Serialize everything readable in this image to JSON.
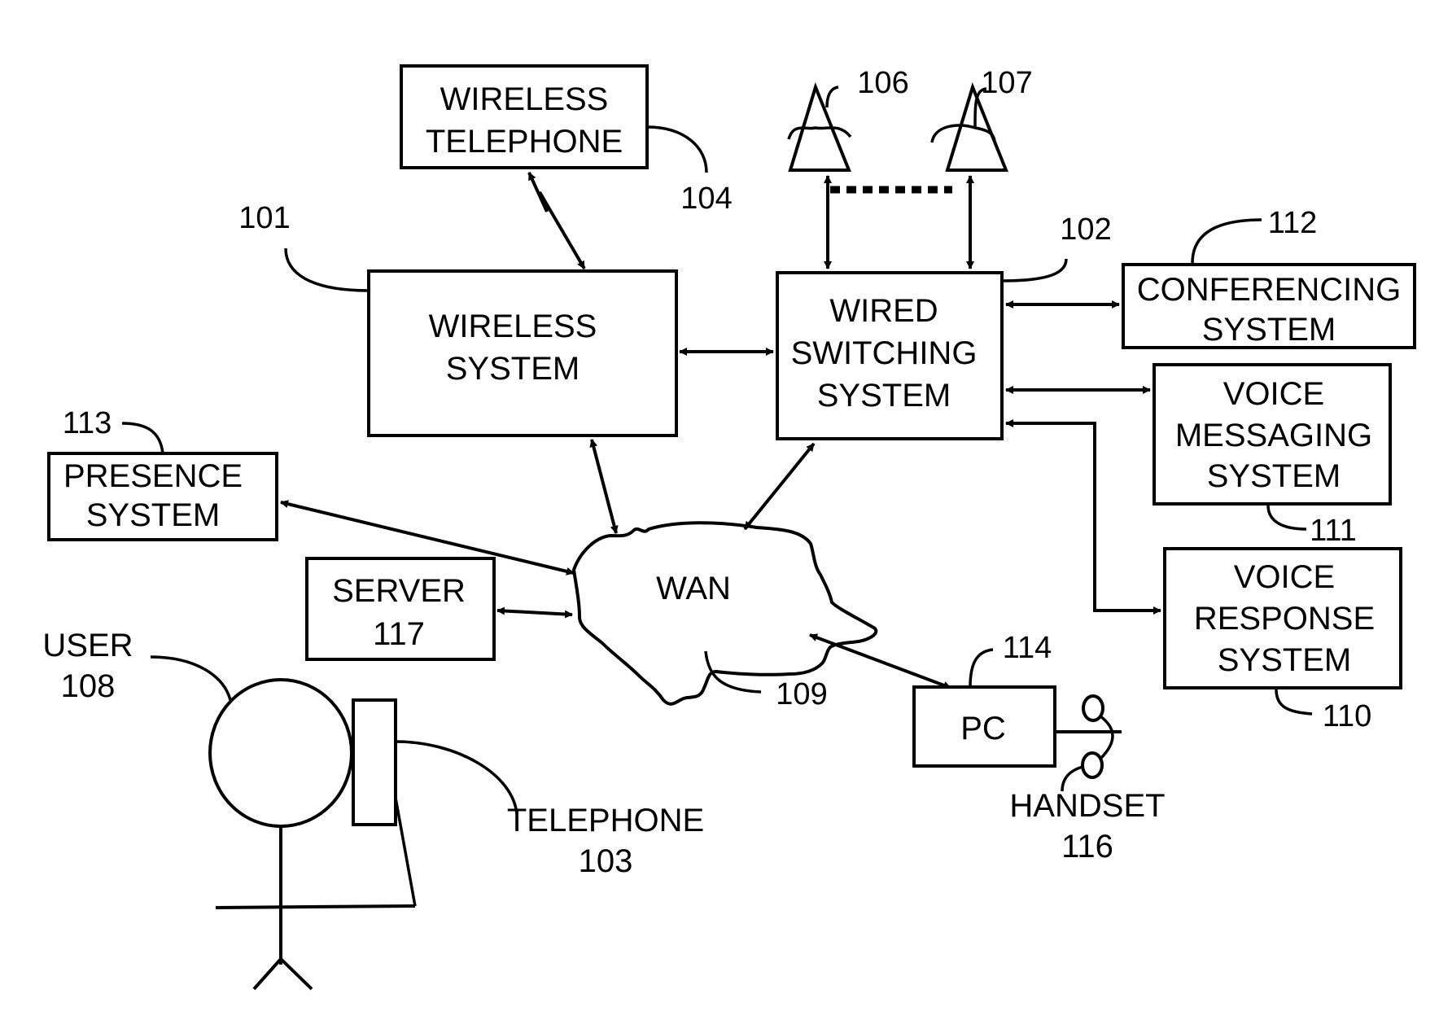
{
  "diagram": {
    "type": "system block diagram",
    "nodes": {
      "wireless_telephone": {
        "lines": [
          "WIRELESS",
          "TELEPHONE"
        ],
        "ref": "104"
      },
      "wireless_system": {
        "lines": [
          "WIRELESS",
          "SYSTEM"
        ],
        "ref": "101"
      },
      "wired_switching_system": {
        "lines": [
          "WIRED",
          "SWITCHING",
          "SYSTEM"
        ],
        "ref": "102"
      },
      "conferencing_system": {
        "lines": [
          "CONFERENCING",
          "SYSTEM"
        ],
        "ref": "112"
      },
      "voice_messaging_system": {
        "lines": [
          "VOICE",
          "MESSAGING",
          "SYSTEM"
        ],
        "ref": "111"
      },
      "voice_response_system": {
        "lines": [
          "VOICE",
          "RESPONSE",
          "SYSTEM"
        ],
        "ref": "110"
      },
      "presence_system": {
        "lines": [
          "PRESENCE",
          "SYSTEM"
        ],
        "ref": "113"
      },
      "server": {
        "lines": [
          "SERVER",
          "117"
        ]
      },
      "wan": {
        "lines": [
          "WAN"
        ],
        "ref": "109"
      },
      "pc": {
        "lines": [
          "PC"
        ],
        "ref": "114"
      },
      "user": {
        "lines": [
          "USER",
          "108"
        ]
      },
      "telephone": {
        "lines": [
          "TELEPHONE",
          "103"
        ]
      },
      "handset": {
        "lines": [
          "HANDSET",
          "116"
        ]
      },
      "antenna_1": {
        "ref": "106"
      },
      "antenna_2": {
        "ref": "107"
      }
    },
    "edges": [
      {
        "from": "wireless_telephone",
        "to": "wireless_system",
        "type": "wireless-bidirectional"
      },
      {
        "from": "wireless_system",
        "to": "wired_switching_system",
        "type": "bidirectional"
      },
      {
        "from": "antenna_1",
        "to": "wired_switching_system",
        "type": "bidirectional"
      },
      {
        "from": "antenna_2",
        "to": "wired_switching_system",
        "type": "bidirectional"
      },
      {
        "from": "wired_switching_system",
        "to": "conferencing_system",
        "type": "bidirectional"
      },
      {
        "from": "wired_switching_system",
        "to": "voice_messaging_system",
        "type": "bidirectional"
      },
      {
        "from": "wired_switching_system",
        "to": "voice_response_system",
        "type": "bidirectional"
      },
      {
        "from": "wireless_system",
        "to": "wan",
        "type": "bidirectional"
      },
      {
        "from": "wired_switching_system",
        "to": "wan",
        "type": "bidirectional"
      },
      {
        "from": "presence_system",
        "to": "wan",
        "type": "bidirectional"
      },
      {
        "from": "server",
        "to": "wan",
        "type": "bidirectional"
      },
      {
        "from": "wan",
        "to": "pc",
        "type": "bidirectional"
      },
      {
        "from": "pc",
        "to": "handset",
        "type": "line"
      },
      {
        "from": "user",
        "to": "telephone",
        "type": "line"
      }
    ]
  }
}
